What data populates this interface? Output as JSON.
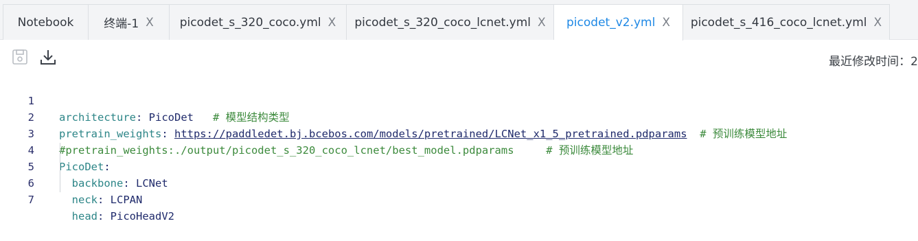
{
  "tabs": [
    {
      "label": "Notebook",
      "closable": false
    },
    {
      "label": "终端-1",
      "closable": true
    },
    {
      "label": "picodet_s_320_coco.yml",
      "closable": true
    },
    {
      "label": "picodet_s_320_coco_lcnet.yml",
      "closable": true
    },
    {
      "label": "picodet_v2.yml",
      "closable": true,
      "active": true
    },
    {
      "label": "picodet_s_416_coco_lcnet.yml",
      "closable": true
    }
  ],
  "close_glyph": "X",
  "toolbar": {
    "save_icon": "save-icon",
    "download_icon": "download-icon",
    "modified_label": "最近修改时间：",
    "modified_value": "2"
  },
  "code": {
    "lines": [
      {
        "n": "1",
        "key": "architecture",
        "sep": ": ",
        "val": "PicoDet",
        "pad": "   ",
        "comment": "# 模型结构类型"
      },
      {
        "n": "2",
        "key": "pretrain_weights",
        "sep": ": ",
        "link": "https://paddledet.bj.bcebos.com/models/pretrained/LCNet_x1_5_pretrained.pdparams",
        "pad": "  ",
        "comment": "# 预训练模型地址"
      },
      {
        "n": "3",
        "comment_line": "#pretrain_weights:./output/picodet_s_320_coco_lcnet/best_model.pdparams",
        "pad": "     ",
        "comment": "# 预训练模型地址"
      },
      {
        "n": "4",
        "key": "PicoDet",
        "sep": ":"
      },
      {
        "n": "5",
        "indent": "  ",
        "key": "backbone",
        "sep": ": ",
        "val": "LCNet"
      },
      {
        "n": "6",
        "indent": "  ",
        "key": "neck",
        "sep": ": ",
        "val": "LCPAN"
      },
      {
        "n": "7",
        "indent": "  ",
        "key": "head",
        "sep": ": ",
        "val": "PicoHeadV2"
      }
    ]
  },
  "colors": {
    "accent": "#1e88e5",
    "key": "#2c8587",
    "value": "#1f2a6b",
    "comment": "#3c8a3c",
    "line_number": "#2b2f6b"
  }
}
